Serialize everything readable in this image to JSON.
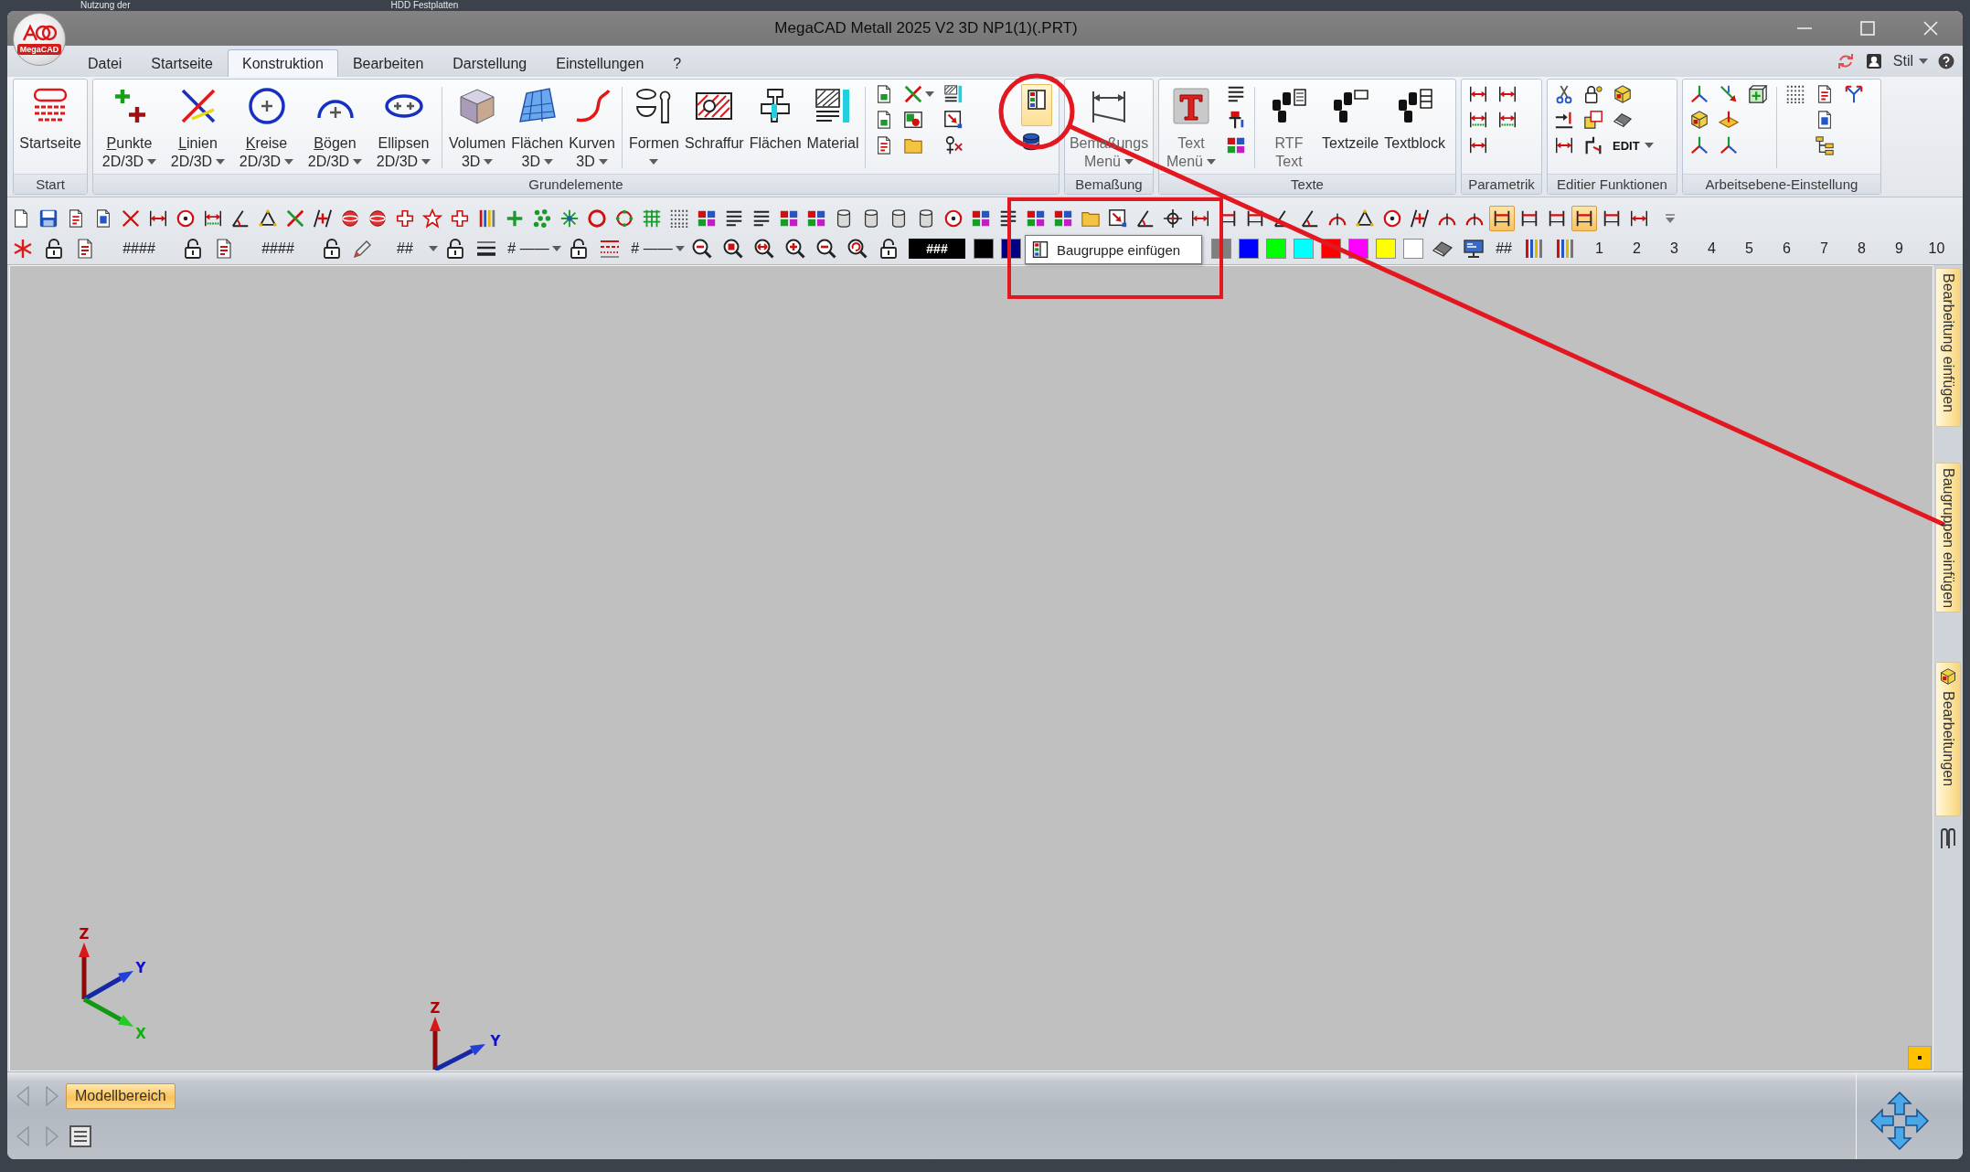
{
  "desktop": {
    "labels": [
      "Nutzung der",
      "HDD Festplatten"
    ]
  },
  "window": {
    "title": "MegaCAD Metall 2025 V2 3D NP1(1)(.PRT)",
    "logo_text": "MegaCAD"
  },
  "menu": {
    "tabs": [
      {
        "label": "Datei",
        "selected": false
      },
      {
        "label": "Startseite",
        "selected": false
      },
      {
        "label": "Konstruktion",
        "selected": true
      },
      {
        "label": "Bearbeiten",
        "selected": false
      },
      {
        "label": "Darstellung",
        "selected": false
      },
      {
        "label": "Einstellungen",
        "selected": false
      },
      {
        "label": "?",
        "selected": false
      }
    ],
    "style_menu": "Stil"
  },
  "ribbon": {
    "groups": [
      {
        "label": "Start",
        "items": [
          {
            "kind": "large",
            "label": "Startseite",
            "dropdown": false,
            "hotkey": false,
            "disabled": false
          }
        ]
      },
      {
        "label": "Grundelemente",
        "items": [
          {
            "kind": "large",
            "label": "Punkte",
            "sublabel": "2D/3D",
            "dropdown": true,
            "hotkey": true,
            "disabled": false
          },
          {
            "kind": "large",
            "label": "Linien",
            "sublabel": "2D/3D",
            "dropdown": true,
            "hotkey": true,
            "disabled": false
          },
          {
            "kind": "large",
            "label": "Kreise",
            "sublabel": "2D/3D",
            "dropdown": true,
            "hotkey": true,
            "disabled": false
          },
          {
            "kind": "large",
            "label": "Bögen",
            "sublabel": "2D/3D",
            "dropdown": true,
            "hotkey": true,
            "disabled": false
          },
          {
            "kind": "large",
            "label": "Ellipsen",
            "sublabel": "2D/3D",
            "dropdown": true,
            "hotkey": false,
            "disabled": false
          },
          {
            "kind": "separator"
          },
          {
            "kind": "large",
            "label": "Volumen",
            "sublabel": "3D",
            "dropdown": true,
            "hotkey": false,
            "disabled": false
          },
          {
            "kind": "large",
            "label": "Flächen",
            "sublabel": "3D",
            "dropdown": true,
            "hotkey": false,
            "disabled": false
          },
          {
            "kind": "large",
            "label": "Kurven",
            "sublabel": "3D",
            "dropdown": true,
            "hotkey": false,
            "disabled": false
          },
          {
            "kind": "separator"
          },
          {
            "kind": "large",
            "label": "Formen",
            "dropdown": true,
            "hotkey": false,
            "disabled": false
          },
          {
            "kind": "large",
            "label": "Schraffur",
            "dropdown": false,
            "hotkey": false,
            "disabled": false
          },
          {
            "kind": "large",
            "label": "Flächen",
            "dropdown": false,
            "hotkey": false,
            "disabled": false
          },
          {
            "kind": "large",
            "label": "Material",
            "dropdown": false,
            "hotkey": false,
            "disabled": false
          },
          {
            "kind": "separator"
          },
          {
            "kind": "column",
            "buttons": [
              {
                "kind": "icon",
                "highlighted": false
              },
              {
                "kind": "icon",
                "highlighted": false
              },
              {
                "kind": "icon",
                "highlighted": false
              }
            ]
          },
          {
            "kind": "column",
            "buttons": [
              {
                "kind": "icon_dropdown",
                "highlighted": false
              },
              {
                "kind": "icon",
                "highlighted": false
              },
              {
                "kind": "icon",
                "highlighted": false
              }
            ]
          },
          {
            "kind": "column",
            "buttons": [
              {
                "kind": "icon",
                "highlighted": false
              },
              {
                "kind": "icon",
                "highlighted": false
              },
              {
                "kind": "icon",
                "highlighted": false
              }
            ]
          },
          {
            "kind": "column",
            "buttons": [
              {
                "kind": "icon",
                "highlighted": true
              },
              {
                "kind": "icon",
                "highlighted": false
              }
            ]
          }
        ]
      },
      {
        "label": "Bemaßung",
        "items": [
          {
            "kind": "large",
            "label": "Bemaßungs",
            "sublabel": "Menü",
            "dropdown": true,
            "hotkey": false,
            "disabled": true
          }
        ]
      },
      {
        "label": "Texte",
        "items": [
          {
            "kind": "large",
            "label": "Text",
            "sublabel": "Menü",
            "dropdown": true,
            "hotkey": false,
            "disabled": true
          },
          {
            "kind": "column",
            "buttons": [
              {
                "kind": "icon",
                "highlighted": false
              },
              {
                "kind": "icon",
                "highlighted": false
              },
              {
                "kind": "icon",
                "highlighted": false
              }
            ]
          },
          {
            "kind": "separator"
          },
          {
            "kind": "large",
            "label": "RTF",
            "sublabel": "Text",
            "dropdown": false,
            "hotkey": false,
            "disabled": true
          },
          {
            "kind": "large",
            "label": "Textzeile",
            "dropdown": false,
            "hotkey": false,
            "disabled": false
          },
          {
            "kind": "large",
            "label": "Textblock",
            "dropdown": false,
            "hotkey": false,
            "disabled": false
          }
        ]
      },
      {
        "label": "Parametrik",
        "items": [
          {
            "kind": "column",
            "buttons": [
              {
                "kind": "icon",
                "highlighted": false
              },
              {
                "kind": "icon",
                "highlighted": false
              },
              {
                "kind": "icon",
                "highlighted": false
              }
            ]
          },
          {
            "kind": "column",
            "buttons": [
              {
                "kind": "icon",
                "highlighted": false
              },
              {
                "kind": "icon",
                "highlighted": false
              }
            ]
          }
        ]
      },
      {
        "label": "Editier Funktionen",
        "items": [
          {
            "kind": "column",
            "buttons": [
              {
                "kind": "icon",
                "highlighted": false
              },
              {
                "kind": "icon",
                "highlighted": false
              },
              {
                "kind": "icon",
                "highlighted": false
              }
            ]
          },
          {
            "kind": "column",
            "buttons": [
              {
                "kind": "icon",
                "highlighted": false
              },
              {
                "kind": "icon",
                "highlighted": false
              },
              {
                "kind": "icon",
                "highlighted": false
              }
            ]
          },
          {
            "kind": "column",
            "buttons": [
              {
                "kind": "icon",
                "highlighted": false
              },
              {
                "kind": "icon",
                "highlighted": false
              },
              {
                "kind": "text_dropdown",
                "label": "EDIT",
                "highlighted": false
              }
            ]
          }
        ]
      },
      {
        "label": "Arbeitsebene-Einstellung",
        "items": [
          {
            "kind": "column",
            "buttons": [
              {
                "kind": "icon",
                "highlighted": false
              },
              {
                "kind": "icon",
                "highlighted": false
              },
              {
                "kind": "icon",
                "highlighted": false
              }
            ]
          },
          {
            "kind": "column",
            "buttons": [
              {
                "kind": "icon",
                "highlighted": false
              },
              {
                "kind": "icon",
                "highlighted": false
              },
              {
                "kind": "icon",
                "highlighted": false
              }
            ]
          },
          {
            "kind": "column",
            "buttons": [
              {
                "kind": "icon",
                "highlighted": false
              }
            ]
          },
          {
            "kind": "separator"
          },
          {
            "kind": "column",
            "buttons": [
              {
                "kind": "icon",
                "highlighted": false
              }
            ]
          },
          {
            "kind": "column",
            "buttons": [
              {
                "kind": "icon",
                "highlighted": false
              },
              {
                "kind": "icon",
                "highlighted": false
              },
              {
                "kind": "icon",
                "highlighted": false
              }
            ]
          },
          {
            "kind": "column",
            "buttons": [
              {
                "kind": "icon",
                "highlighted": false
              }
            ]
          }
        ]
      }
    ]
  },
  "toolbar_1": [
    {
      "on": false
    },
    {
      "on": false
    },
    {
      "on": false
    },
    {
      "on": false
    },
    {
      "on": false
    },
    {
      "on": false
    },
    {
      "on": false
    },
    {
      "on": false
    },
    {
      "on": false
    },
    {
      "on": false
    },
    {
      "on": false
    },
    {
      "on": false
    },
    {
      "on": false
    },
    {
      "on": false
    },
    {
      "on": false
    },
    {
      "on": false
    },
    {
      "on": false
    },
    {
      "on": false
    },
    {
      "on": false
    },
    {
      "on": false
    },
    {
      "on": false
    },
    {
      "on": false
    },
    {
      "on": false
    },
    {
      "on": false
    },
    {
      "on": false
    },
    {
      "on": false
    },
    {
      "on": false
    },
    {
      "on": false
    },
    {
      "on": false
    },
    {
      "on": false
    },
    {
      "on": false
    },
    {
      "on": false
    },
    {
      "on": false
    },
    {
      "on": false
    },
    {
      "on": false
    },
    {
      "on": false
    },
    {
      "on": false
    },
    {
      "on": false
    },
    {
      "on": false
    },
    {
      "on": false
    },
    {
      "on": false
    },
    {
      "on": false
    },
    {
      "on": false
    },
    {
      "on": false
    },
    {
      "on": false
    },
    {
      "on": false
    },
    {
      "on": false
    },
    {
      "on": false
    },
    {
      "on": false
    },
    {
      "on": false
    },
    {
      "on": false
    },
    {
      "on": false
    },
    {
      "on": false
    },
    {
      "on": false
    },
    {
      "on": true
    },
    {
      "on": false
    },
    {
      "on": false
    },
    {
      "on": true
    },
    {
      "on": false
    },
    {
      "on": false
    }
  ],
  "toolbar_2": {
    "left": [
      {
        "kind": "icon"
      },
      {
        "kind": "icon"
      },
      {
        "kind": "icon"
      },
      {
        "kind": "text",
        "text": "####"
      },
      {
        "kind": "icon"
      },
      {
        "kind": "icon"
      },
      {
        "kind": "text",
        "text": "####"
      },
      {
        "kind": "icon"
      },
      {
        "kind": "icon"
      },
      {
        "kind": "select",
        "text": "##"
      },
      {
        "kind": "icon"
      },
      {
        "kind": "icon"
      },
      {
        "kind": "select",
        "text": "# ——"
      },
      {
        "kind": "icon"
      },
      {
        "kind": "icon"
      },
      {
        "kind": "select",
        "text": "# ——"
      },
      {
        "kind": "icon"
      },
      {
        "kind": "icon"
      },
      {
        "kind": "icon"
      },
      {
        "kind": "icon"
      },
      {
        "kind": "icon"
      },
      {
        "kind": "icon"
      },
      {
        "kind": "icon"
      },
      {
        "kind": "display",
        "text": "###"
      },
      {
        "kind": "swatch",
        "color": "#000000"
      },
      {
        "kind": "swatch",
        "color": "#000080"
      }
    ],
    "right": [
      {
        "kind": "swatch",
        "color": "#808080"
      },
      {
        "kind": "swatch",
        "color": "#0000ff"
      },
      {
        "kind": "swatch",
        "color": "#00ff00"
      },
      {
        "kind": "swatch",
        "color": "#00ffff"
      },
      {
        "kind": "swatch",
        "color": "#ff0000"
      },
      {
        "kind": "swatch",
        "color": "#ff00ff"
      },
      {
        "kind": "swatch",
        "color": "#ffff00"
      },
      {
        "kind": "swatch",
        "color": "#ffffff"
      },
      {
        "kind": "icon"
      },
      {
        "kind": "icon"
      },
      {
        "kind": "text",
        "text": "##"
      },
      {
        "kind": "icon"
      },
      {
        "kind": "icon"
      },
      {
        "kind": "number",
        "text": "1"
      },
      {
        "kind": "number",
        "text": "2"
      },
      {
        "kind": "number",
        "text": "3"
      },
      {
        "kind": "number",
        "text": "4"
      },
      {
        "kind": "number",
        "text": "5"
      },
      {
        "kind": "number",
        "text": "6"
      },
      {
        "kind": "number",
        "text": "7"
      },
      {
        "kind": "number",
        "text": "8"
      },
      {
        "kind": "number",
        "text": "9"
      },
      {
        "kind": "number",
        "text": "10"
      }
    ]
  },
  "tooltip": {
    "text": "Baugruppe einfügen"
  },
  "canvas": {
    "axes": [
      {
        "labels": [
          "Z",
          "Y",
          "X"
        ]
      },
      {
        "labels": [
          "Z",
          "Y"
        ]
      }
    ]
  },
  "side_tabs": [
    {
      "kind": "plain",
      "label": "Bearbeitung einfügen"
    },
    {
      "kind": "plain",
      "label": "Baugruppen einfügen"
    },
    {
      "kind": "with_icon",
      "label": "Bearbeitungen"
    }
  ],
  "bottom": {
    "layout_tabs": [
      {
        "label": "Modellbereich",
        "selected": true
      }
    ]
  }
}
